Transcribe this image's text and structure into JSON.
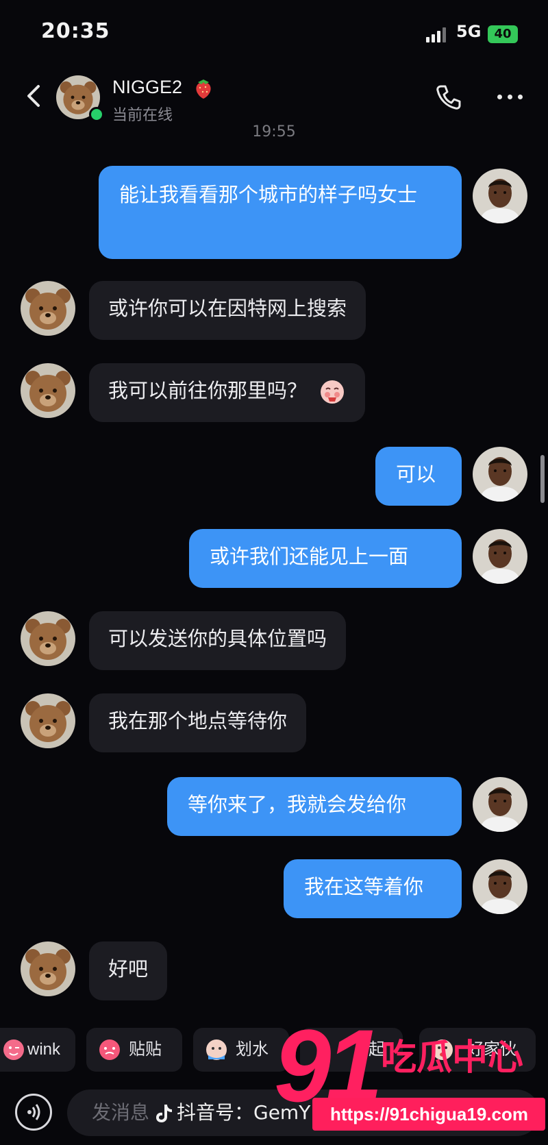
{
  "status_bar": {
    "time": "20:35",
    "network": "5G",
    "battery": "40"
  },
  "header": {
    "contact_name": "NIGGE2",
    "online_status": "当前在线"
  },
  "chat": {
    "timestamp": "19:55",
    "messages": [
      {
        "side": "out",
        "text": "能让我看看那个城市的样子吗女士"
      },
      {
        "side": "in",
        "text": "或许你可以在因特网上搜索"
      },
      {
        "side": "in",
        "text": "我可以前往你那里吗？"
      },
      {
        "side": "out",
        "text": "可以"
      },
      {
        "side": "out",
        "text": "或许我们还能见上一面"
      },
      {
        "side": "in",
        "text": "可以发送你的具体位置吗"
      },
      {
        "side": "in",
        "text": "我在那个地点等待你"
      },
      {
        "side": "out",
        "text": "等你来了，我就会发给你"
      },
      {
        "side": "out",
        "text": "我在这等着你"
      },
      {
        "side": "in",
        "text": "好吧"
      }
    ]
  },
  "stickers": [
    {
      "label": "wink"
    },
    {
      "label": "贴贴"
    },
    {
      "label": "划水"
    },
    {
      "label": "起"
    },
    {
      "label": "好家伙"
    }
  ],
  "input": {
    "placeholder": "发消息"
  },
  "watermark": {
    "brand_number": "91",
    "brand_name": "吃瓜中心",
    "url": "https://91chigua19.com",
    "douyin": "抖音号：GemY"
  },
  "colors": {
    "outgoing_bubble": "#3d94f6",
    "incoming_bubble": "#1c1c22",
    "background": "#07070b",
    "watermark": "#ff2060"
  }
}
